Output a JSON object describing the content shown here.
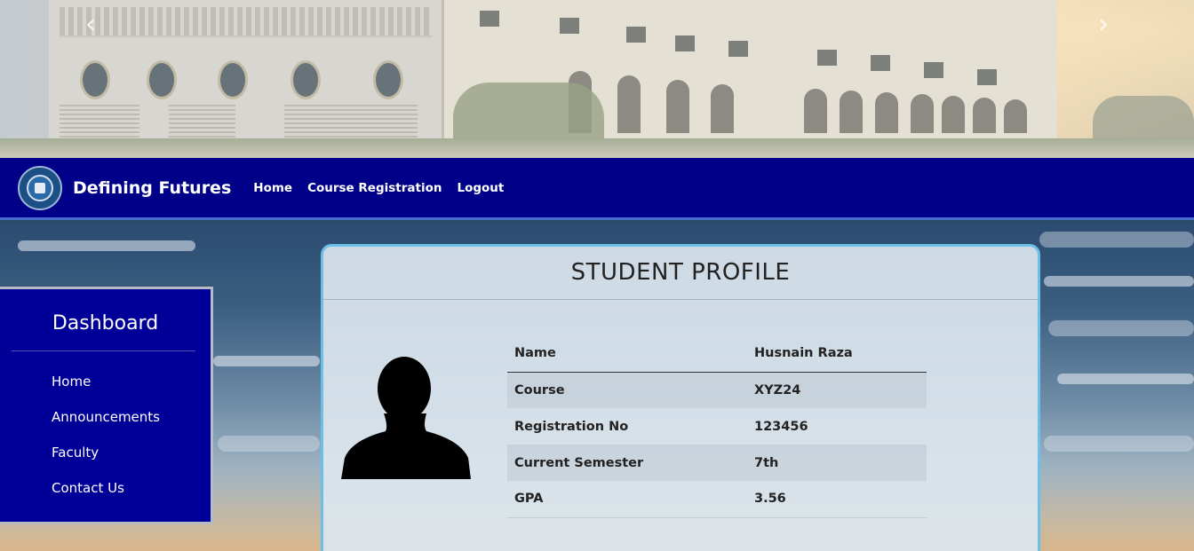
{
  "banner": {
    "prev_arrow": "‹",
    "next_arrow": "›"
  },
  "navbar": {
    "brand": "Defining Futures",
    "links": [
      {
        "label": "Home"
      },
      {
        "label": "Course Registration"
      },
      {
        "label": "Logout"
      }
    ]
  },
  "dashboard": {
    "title": "Dashboard",
    "items": [
      {
        "label": "Home"
      },
      {
        "label": "Announcements"
      },
      {
        "label": "Faculty"
      },
      {
        "label": "Contact Us"
      }
    ]
  },
  "profile": {
    "title": "STUDENT PROFILE",
    "fields": [
      {
        "label": "Name",
        "value": "Husnain Raza"
      },
      {
        "label": "Course",
        "value": "XYZ24"
      },
      {
        "label": "Registration No",
        "value": "123456"
      },
      {
        "label": "Current Semester",
        "value": "7th"
      },
      {
        "label": "GPA",
        "value": "3.56"
      }
    ]
  },
  "colors": {
    "navbar_bg": "#000088",
    "dashboard_bg": "#000099",
    "card_border": "#6cc0e6"
  },
  "icons": {
    "avatar": "user-silhouette-icon",
    "logo": "university-seal-icon"
  }
}
